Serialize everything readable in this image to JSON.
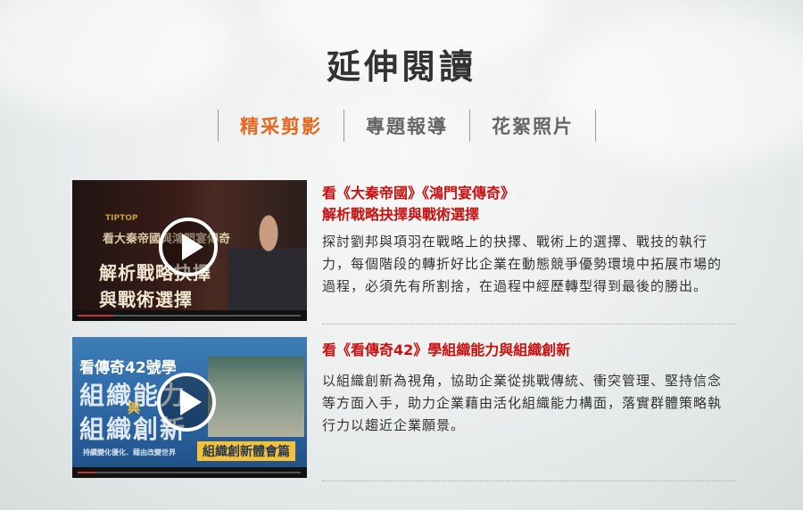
{
  "page": {
    "title": "延伸閱讀",
    "tabs": [
      "精采剪影",
      "專題報導",
      "花絮照片"
    ],
    "active_tab": "精采剪影",
    "accent_color": "#e8671d",
    "headline_color": "#cc0f0f"
  },
  "items": [
    {
      "headline_line1": "看《大秦帝國》《鴻門宴傳奇》",
      "headline_line2": "解析戰略抉擇與戰術選擇",
      "description": "探討劉邦與項羽在戰略上的抉擇、戰術上的選擇、戰技的執行力，每個階段的轉折好比企業在動態競爭優勢環境中拓展市場的過程，必須先有所割捨，在過程中經歷轉型得到最後的勝出。",
      "thumb": {
        "logo": "TIPTOP",
        "line_a": "看大秦帝國與鴻門宴傳奇",
        "line_b": "解析戰略抉擇",
        "line_c": "與戰術選擇"
      }
    },
    {
      "headline_line1": "看《看傳奇42》學組織能力與組織創新",
      "description": "以組織創新為視角，協助企業從挑戰傳統、衝突管理、堅持信念等方面入手，助力企業藉由活化組織能力構面，落實群體策略執行力以趨近企業願景。",
      "thumb": {
        "line_a": "看傳奇42號學",
        "line_b": "組織能力",
        "line_mid": "與",
        "line_c": "組織創新",
        "banner": "組織創新體會篇",
        "footer": "持續變化優化．藉由改變世界"
      }
    }
  ]
}
